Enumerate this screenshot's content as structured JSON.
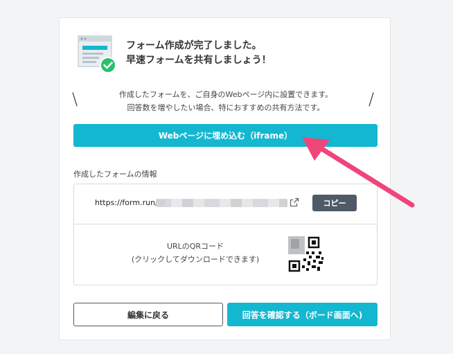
{
  "header": {
    "title_line1": "フォーム作成が完了しました。",
    "title_line2": "早速フォームを共有しましょう！",
    "illustration_icon": "form-complete-check-icon"
  },
  "description": {
    "slash_left": "\\",
    "slash_right": "/",
    "line1": "作成したフォームを、ご自身のWebページ内に設置できます。",
    "line2": "回答数を増やしたい場合、特におすすめの共有方法です。"
  },
  "embed_button": {
    "label": "Webページに埋め込む（iframe）"
  },
  "form_info": {
    "section_label": "作成したフォームの情報",
    "url_prefix": "https://form.run/@",
    "external_link_icon": "external-link-icon",
    "copy_label": "コピー",
    "qr_line1": "URLのQRコード",
    "qr_line2": "(クリックしてダウンロードできます)",
    "qr_icon": "qr-code-icon"
  },
  "footer": {
    "back_label": "編集に戻る",
    "confirm_label": "回答を確認する（ボード画面へ)"
  },
  "colors": {
    "accent": "#14b7d0",
    "dark_button": "#4e5a66",
    "check_green": "#2bbf6e",
    "annotation_arrow": "#f0457a"
  }
}
